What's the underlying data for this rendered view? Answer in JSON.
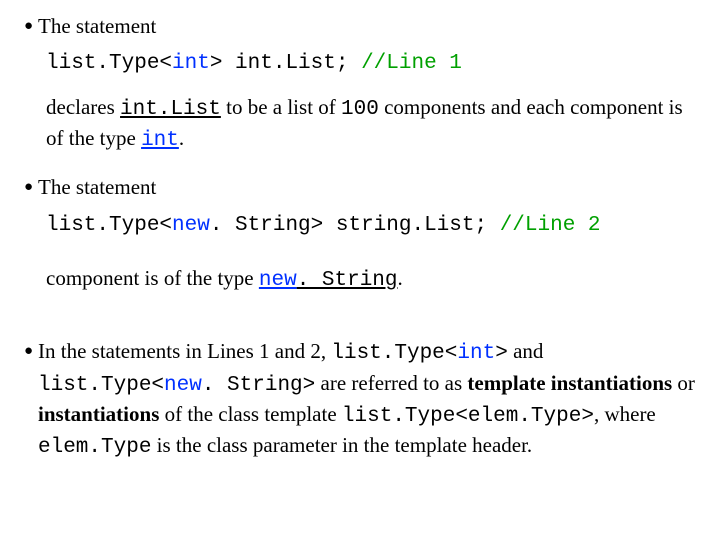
{
  "line1_lead": "The statement",
  "code1": {
    "pre": "list.Type<",
    "kw": "int",
    "post": "> int.List; ",
    "cmt": "//Line 1"
  },
  "decl1": {
    "a": "declares ",
    "b": "int.List",
    "c": " to be a list of ",
    "d": "100",
    "e": " components and each component is of the type ",
    "f": "int",
    "g": "."
  },
  "line2_lead": "The statement",
  "code2": {
    "pre": "list.Type<",
    "kw": "new",
    "mid": ". String> string.List; ",
    "cmt": "//Line 2"
  },
  "decl2": {
    "a": "component is of the type ",
    "b": "new",
    "c": ". String",
    "d": "."
  },
  "para3": {
    "a": "In the statements in Lines 1 and 2, ",
    "b": "list.Type<",
    "c": "int",
    "d": ">",
    "e": " and ",
    "f": "list.Type<",
    "g": "new",
    "h": ". String>",
    "i": "  are referred to as ",
    "j": "template instantiations",
    "k": " or ",
    "l": "instantiations",
    "m": " of the class template ",
    "n": "list.Type<elem.Type>",
    "o": ", where ",
    "p": "elem.Type",
    "q": " is the class parameter in the template header."
  }
}
